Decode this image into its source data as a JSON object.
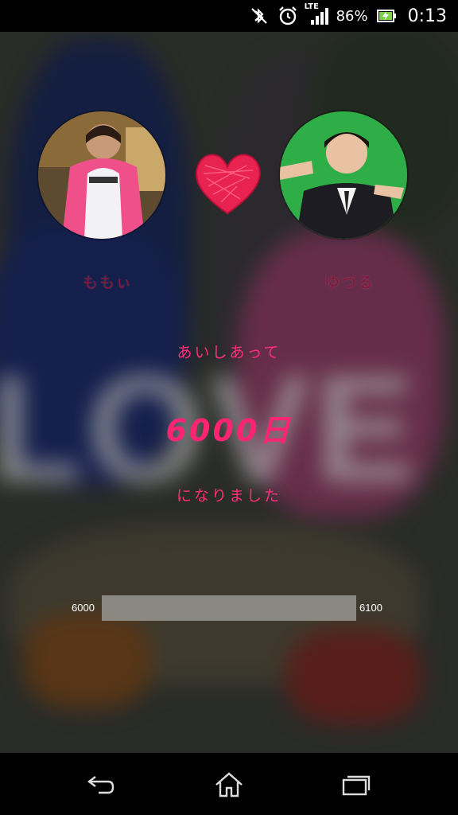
{
  "status_bar": {
    "network": "LTE",
    "battery_percent": "86%",
    "time": "0:13",
    "icons": [
      "bluetooth-off-icon",
      "alarm-clock-icon",
      "signal-icon",
      "battery-charging-icon"
    ]
  },
  "couple": {
    "left_name": "ももぃ",
    "right_name": "ゆづる",
    "heart_color": "#e8234f"
  },
  "message": {
    "line1": "あいしあって",
    "days": "6000日",
    "line2": "になりました"
  },
  "progress": {
    "min_label": "6000",
    "max_label": "6100",
    "fraction": 0.0
  },
  "nav": {
    "icons": [
      "back-icon",
      "home-icon",
      "recent-apps-icon"
    ]
  },
  "colors": {
    "accent_pink": "#ff2f78",
    "name_color": "#8a1538"
  }
}
